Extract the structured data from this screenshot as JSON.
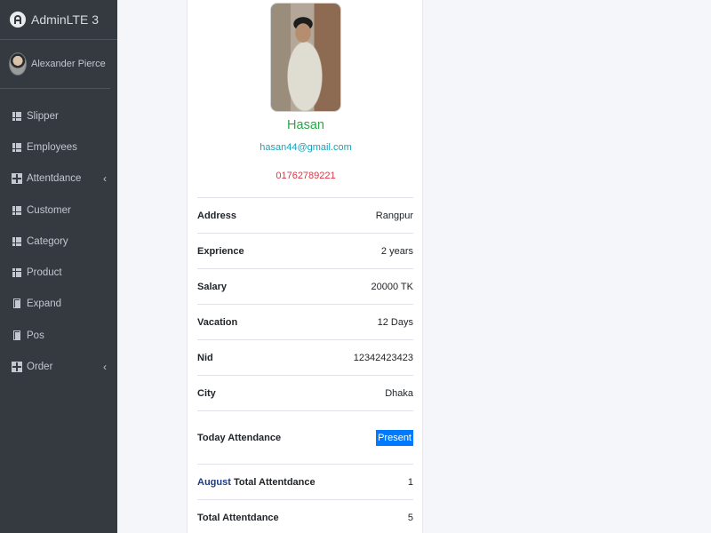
{
  "brand": {
    "title": "AdminLTE 3"
  },
  "user": {
    "name": "Alexander Pierce"
  },
  "sidebar": {
    "items": [
      {
        "label": "Slipper",
        "icon": "grid-icon"
      },
      {
        "label": "Employees",
        "icon": "grid-icon"
      },
      {
        "label": "Attentdance",
        "icon": "table-icon",
        "arrow": "‹"
      },
      {
        "label": "Customer",
        "icon": "grid-icon"
      },
      {
        "label": "Category",
        "icon": "grid-icon"
      },
      {
        "label": "Product",
        "icon": "grid-icon"
      },
      {
        "label": "Expand",
        "icon": "copy-icon"
      },
      {
        "label": "Pos",
        "icon": "copy-icon"
      },
      {
        "label": "Order",
        "icon": "table-icon",
        "arrow": "‹"
      }
    ]
  },
  "profile": {
    "name": "Hasan",
    "email": "hasan44@gmail.com",
    "phone": "01762789221",
    "details": [
      {
        "label": "Address",
        "value": "Rangpur"
      },
      {
        "label": "Exprience",
        "value": "2 years"
      },
      {
        "label": "Salary",
        "value": "20000 TK"
      },
      {
        "label": "Vacation",
        "value": "12 Days"
      },
      {
        "label": "Nid",
        "value": "12342423423"
      },
      {
        "label": "City",
        "value": "Dhaka"
      }
    ],
    "today_attendance": {
      "label": "Today Attendance",
      "status": "Present"
    },
    "month_attendance": {
      "month": "August",
      "label": "Total Attentdance",
      "value": "1"
    },
    "total_attendance": {
      "label": "Total Attentdance",
      "value": "5"
    }
  },
  "colors": {
    "sidebar_bg": "#343a40",
    "name": "#28a745",
    "email": "#17a2b8",
    "phone": "#dc3545",
    "badge": "#007bff"
  }
}
